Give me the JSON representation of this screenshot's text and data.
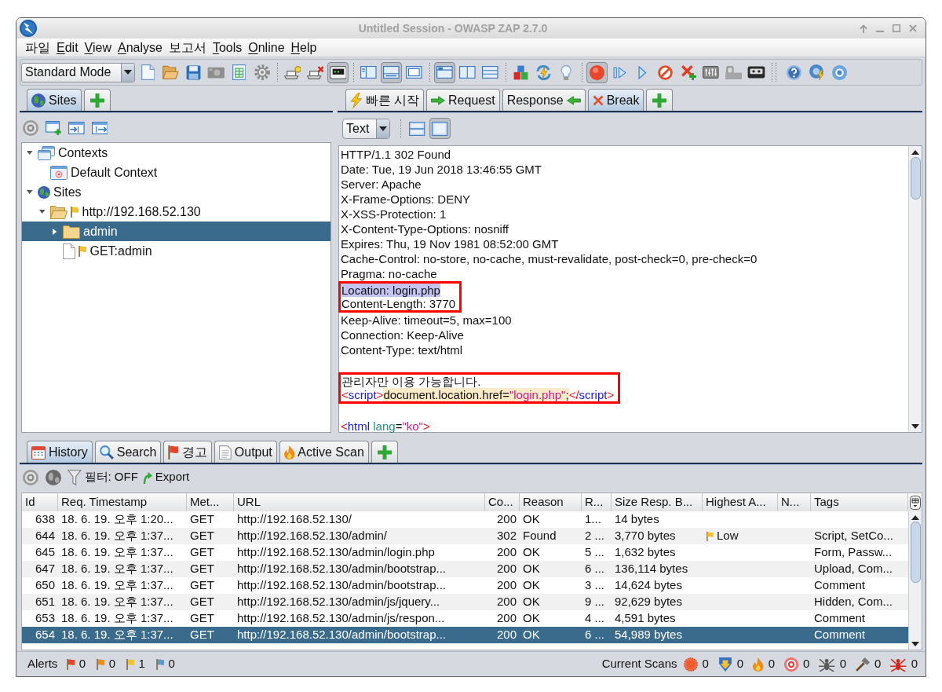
{
  "window": {
    "title": "Untitled Session - OWASP ZAP 2.7.0"
  },
  "menu": [
    {
      "label": "파일",
      "mnemonic": false
    },
    {
      "label": "Edit",
      "mnemonic": true
    },
    {
      "label": "View",
      "mnemonic": true
    },
    {
      "label": "Analyse",
      "mnemonic": true
    },
    {
      "label": "보고서",
      "mnemonic": false
    },
    {
      "label": "Tools",
      "mnemonic": true
    },
    {
      "label": "Online",
      "mnemonic": true
    },
    {
      "label": "Help",
      "mnemonic": true
    }
  ],
  "toolbar": {
    "mode": "Standard Mode",
    "groups": [
      [
        {
          "pressed": false
        },
        {
          "pressed": false
        },
        {
          "pressed": false
        },
        {
          "pressed": false
        },
        {
          "pressed": false
        },
        {
          "pressed": false
        }
      ],
      [
        {
          "pressed": false
        },
        {
          "pressed": false
        },
        {
          "pressed": true
        }
      ],
      [
        {
          "pressed": false
        },
        {
          "pressed": true
        },
        {
          "pressed": false
        }
      ],
      [
        {
          "pressed": true
        },
        {
          "pressed": false
        },
        {
          "pressed": false
        }
      ],
      [
        {
          "pressed": false
        },
        {
          "pressed": false
        },
        {
          "pressed": false
        }
      ],
      [
        {
          "pressed": true
        },
        {
          "pressed": false
        },
        {
          "pressed": false
        },
        {
          "pressed": false
        },
        {
          "pressed": false
        },
        {
          "pressed": false
        },
        {
          "pressed": false
        },
        {
          "pressed": false
        }
      ],
      [
        {
          "pressed": false
        },
        {
          "pressed": false
        },
        {
          "pressed": false
        }
      ]
    ]
  },
  "sites_panel": {
    "tabs": [
      {
        "label": "Sites",
        "selected": true
      }
    ],
    "tree": [
      {
        "kind": "contexts",
        "label": "Contexts",
        "expanded": true,
        "selected": false,
        "children": [
          {
            "kind": "context",
            "label": "Default Context",
            "selected": false
          }
        ]
      },
      {
        "kind": "sites",
        "label": "Sites",
        "expanded": true,
        "selected": false,
        "children": [
          {
            "kind": "folder",
            "label": "http://192.168.52.130",
            "expanded": true,
            "flagged": true,
            "selected": false,
            "children": [
              {
                "kind": "folder",
                "label": "admin",
                "expanded": false,
                "flagged": false,
                "selected": true
              },
              {
                "kind": "page",
                "label": "GET:admin",
                "flagged": true,
                "selected": false
              }
            ]
          }
        ]
      }
    ]
  },
  "message_panel": {
    "tabs": [
      {
        "label": "빠른 시작",
        "selected": false
      },
      {
        "label": "Request",
        "selected": false
      },
      {
        "label": "Response",
        "selected": false
      },
      {
        "label": "Break",
        "selected": true
      }
    ],
    "format": "Text",
    "view_buttons": [
      {
        "pressed": false
      },
      {
        "pressed": true
      }
    ],
    "body": [
      {
        "outlined": false,
        "lines": [
          {
            "kind": "plain",
            "text": "HTTP/1.1 302 Found",
            "selected": false
          },
          {
            "kind": "plain",
            "text": "Date: Tue, 19 Jun 2018 13:46:55 GMT",
            "selected": false
          },
          {
            "kind": "plain",
            "text": "Server: Apache",
            "selected": false
          },
          {
            "kind": "plain",
            "text": "X-Frame-Options: DENY",
            "selected": false
          },
          {
            "kind": "plain",
            "text": "X-XSS-Protection: 1",
            "selected": false
          },
          {
            "kind": "plain",
            "text": "X-Content-Type-Options: nosniff",
            "selected": false
          },
          {
            "kind": "plain",
            "text": "Expires: Thu, 19 Nov 1981 08:52:00 GMT",
            "selected": false
          },
          {
            "kind": "plain",
            "text": "Cache-Control: no-store, no-cache, must-revalidate, post-check=0, pre-check=0",
            "selected": false
          },
          {
            "kind": "plain",
            "text": "Pragma: no-cache",
            "selected": false
          }
        ]
      },
      {
        "outlined": true,
        "lines": [
          {
            "kind": "plain",
            "text": "Location: login.php",
            "selected": true
          },
          {
            "kind": "plain",
            "text": "Content-Length: 3770",
            "selected": false
          }
        ]
      },
      {
        "outlined": false,
        "lines": [
          {
            "kind": "plain",
            "text": "Keep-Alive: timeout=5, max=100",
            "selected": false
          },
          {
            "kind": "plain",
            "text": "Connection: Keep-Alive",
            "selected": false
          },
          {
            "kind": "plain",
            "text": "Content-Type: text/html",
            "selected": false
          },
          {
            "kind": "blank"
          }
        ]
      },
      {
        "outlined": true,
        "lines": [
          {
            "kind": "plain",
            "text": "관리자만 이용 가능합니다.",
            "selected": false
          },
          {
            "kind": "code",
            "tokens": [
              {
                "kind": "bracket",
                "text": "<"
              },
              {
                "kind": "tag",
                "text": "script"
              },
              {
                "kind": "bracket",
                "text": ">"
              },
              {
                "kind": "script",
                "text": "document.location.href="
              },
              {
                "kind": "script_string",
                "text": "\"login.php\""
              },
              {
                "kind": "script",
                "text": ";"
              },
              {
                "kind": "bracket",
                "text": "</"
              },
              {
                "kind": "tag",
                "text": "script"
              },
              {
                "kind": "bracket",
                "text": ">"
              }
            ]
          }
        ]
      },
      {
        "outlined": false,
        "lines": [
          {
            "kind": "blank"
          },
          {
            "kind": "code",
            "tokens": [
              {
                "kind": "bracket",
                "text": "<"
              },
              {
                "kind": "tag",
                "text": "html"
              },
              {
                "kind": "attribute",
                "text": " lang"
              },
              {
                "kind": "plain",
                "text": "="
              },
              {
                "kind": "string",
                "text": "\"ko\""
              },
              {
                "kind": "bracket",
                "text": ">"
              }
            ]
          }
        ]
      }
    ]
  },
  "history_panel": {
    "tabs": [
      {
        "label": "History",
        "selected": true
      },
      {
        "label": "Search",
        "selected": false
      },
      {
        "label": "경고",
        "selected": false
      },
      {
        "label": "Output",
        "selected": false
      },
      {
        "label": "Active Scan",
        "selected": false
      }
    ],
    "filter": "필터: OFF",
    "export": "Export",
    "table": {
      "columns": [
        "Id",
        "Req. Timestamp",
        "Met...",
        "URL",
        "Co...",
        "Reason",
        "R...",
        "Size Resp. B...",
        "Highest A...",
        "N...",
        "Tags"
      ],
      "rows": [
        {
          "selected": false,
          "cells": [
            "638",
            "18. 6. 19. 오후 1:20...",
            "GET",
            "http://192.168.52.130/",
            "200",
            "OK",
            "1...",
            "14 bytes"
          ]
        },
        {
          "selected": false,
          "cells": [
            "644",
            "18. 6. 19. 오후 1:37...",
            "GET",
            "http://192.168.52.130/admin/",
            "302",
            "Found",
            "2 ...",
            "3,770 bytes",
            "Low",
            null,
            "Script, SetCo..."
          ]
        },
        {
          "selected": false,
          "cells": [
            "645",
            "18. 6. 19. 오후 1:37...",
            "GET",
            "http://192.168.52.130/admin/login.php",
            "200",
            "OK",
            "5 ...",
            "1,632 bytes",
            null,
            null,
            "Form, Passw..."
          ]
        },
        {
          "selected": false,
          "cells": [
            "647",
            "18. 6. 19. 오후 1:37...",
            "GET",
            "http://192.168.52.130/admin/bootstrap...",
            "200",
            "OK",
            "6 ...",
            "136,114 bytes",
            null,
            null,
            "Upload, Com..."
          ]
        },
        {
          "selected": false,
          "cells": [
            "650",
            "18. 6. 19. 오후 1:37...",
            "GET",
            "http://192.168.52.130/admin/bootstrap...",
            "200",
            "OK",
            "3 ...",
            "14,624 bytes",
            null,
            null,
            "Comment"
          ]
        },
        {
          "selected": false,
          "cells": [
            "651",
            "18. 6. 19. 오후 1:37...",
            "GET",
            "http://192.168.52.130/admin/js/jquery...",
            "200",
            "OK",
            "9 ...",
            "92,629 bytes",
            null,
            null,
            "Hidden, Com..."
          ]
        },
        {
          "selected": false,
          "cells": [
            "653",
            "18. 6. 19. 오후 1:37...",
            "GET",
            "http://192.168.52.130/admin/js/respon...",
            "200",
            "OK",
            "4 ...",
            "4,591 bytes",
            null,
            null,
            "Comment"
          ]
        },
        {
          "selected": true,
          "cells": [
            "654",
            "18. 6. 19. 오후 1:37...",
            "GET",
            "http://192.168.52.130/admin/bootstrap...",
            "200",
            "OK",
            "6 ...",
            "54,989 bytes",
            null,
            null,
            "Comment"
          ]
        }
      ]
    }
  },
  "status_bar": {
    "alerts_label": "Alerts",
    "alerts": [
      {
        "count": "0",
        "color": "#e8412c"
      },
      {
        "count": "0",
        "color": "#f08c1c"
      },
      {
        "count": "1",
        "color": "#f2c12e"
      },
      {
        "count": "0",
        "color": "#5b9bd5"
      }
    ],
    "scans_label": "Current Scans",
    "scans": [
      "0",
      "0",
      "0",
      "0",
      "0",
      "0",
      "0"
    ]
  }
}
